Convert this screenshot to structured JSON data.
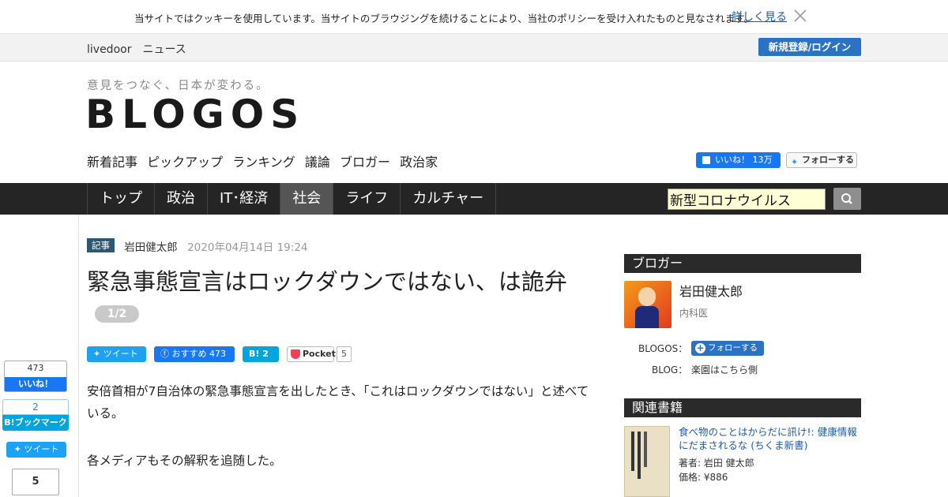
{
  "cookie": {
    "message": "当サイトではクッキーを使用しています。当サイトのブラウジングを続けることにより、当社のポリシーを受け入れたものと見なされます。",
    "more_link": "詳しく見る"
  },
  "topbar": {
    "brand": "livedoor　ニュース",
    "register_login": "新規登録/ログイン"
  },
  "masthead": {
    "tagline": "意見をつなぐ、日本が変わる。",
    "logo": "BLOGOS",
    "subnav": [
      "新着記事",
      "ピックアップ",
      "ランキング",
      "議論",
      "ブロガー",
      "政治家"
    ],
    "fb_like": "いいね！ 13万",
    "tw_follow": "フォローする"
  },
  "mainnav": {
    "items": [
      "トップ",
      "政治",
      "IT･経済",
      "社会",
      "ライフ",
      "カルチャー"
    ],
    "active": "社会",
    "search_value": "新型コロナウイルス"
  },
  "rail": {
    "like_count": "473",
    "like_label": "いいね！",
    "bookmark_count": "2",
    "bookmark_label": "B!ブックマーク",
    "tweet_label": "ツイート",
    "pocket_count": "5"
  },
  "article": {
    "tag": "記事",
    "author": "岩田健太郎",
    "date": "2020年04月14日 19:24",
    "title": "緊急事態宣言はロックダウンではない、は詭弁",
    "page_badge": "1/2",
    "share": {
      "tweet": "ツイート",
      "fb": "おすすめ 473",
      "hatena": "B!  2",
      "pocket": "Pocket",
      "pocket_count": "5"
    },
    "paragraphs": [
      "安倍首相が7自治体の緊急事態宣言を出したとき、「これはロックダウンではない」と述べている。",
      "各メディアもその解釈を追随した。"
    ]
  },
  "sidebar": {
    "blogger_heading": "ブロガー",
    "blogger_name": "岩田健太郎",
    "blogger_profession": "内科医",
    "blogos_label": "BLOGOS：",
    "follow_label": "フォローする",
    "blog_label": "BLOG：",
    "blog_name": "楽園はこちら側",
    "books_heading": "関連書籍",
    "book_title": "食べ物のことはからだに訊け!: 健康情報にだまされるな (ちくま新書)",
    "book_author": "著者: 岩田 健太郎",
    "book_price": "価格: ¥886"
  }
}
